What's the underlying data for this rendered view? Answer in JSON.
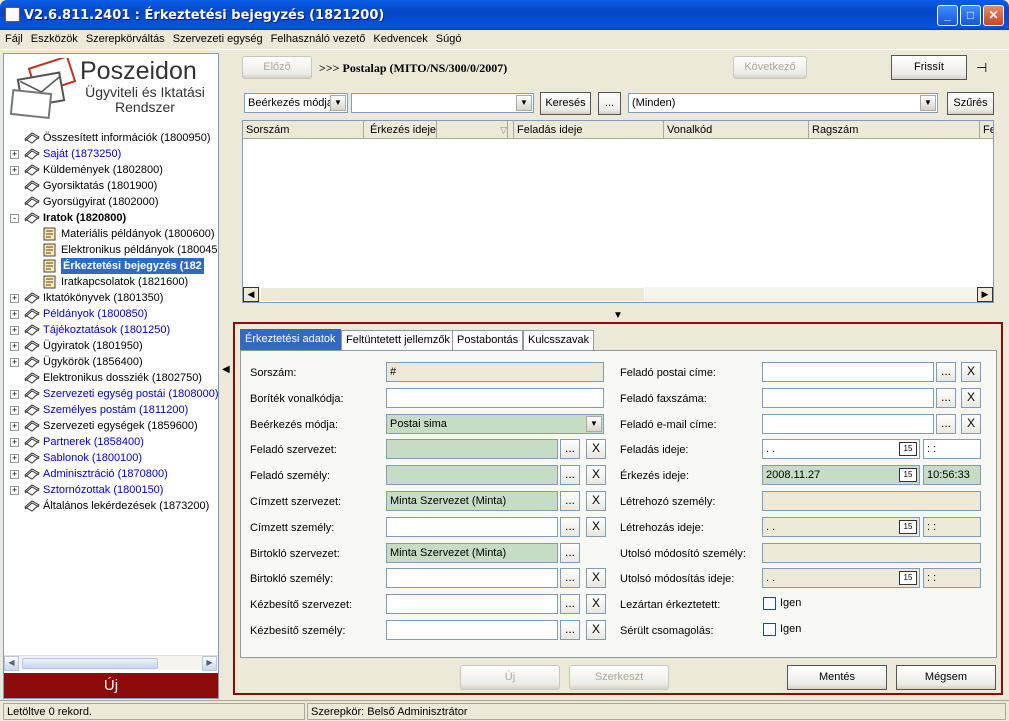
{
  "window": {
    "title": "V2.6.811.2401 : Érkeztetési bejegyzés (1821200)"
  },
  "menu": [
    "Fájl",
    "Eszközök",
    "Szerepkörváltás",
    "Szervezeti egység",
    "Felhasználó vezető",
    "Kedvencek",
    "Súgó"
  ],
  "logo": {
    "name": "Poszeidon",
    "subtitle1": "Ügyviteli és Iktatási",
    "subtitle2": "Rendszer"
  },
  "tree": [
    {
      "label": "Összesített információk (1800950)",
      "blue": false,
      "expander": "",
      "bold": false,
      "selected": false,
      "level": 0
    },
    {
      "label": "Saját (1873250)",
      "blue": true,
      "expander": "+",
      "bold": false,
      "selected": false,
      "level": 0
    },
    {
      "label": "Küldemények (1802800)",
      "blue": false,
      "expander": "+",
      "bold": false,
      "selected": false,
      "level": 0
    },
    {
      "label": "Gyorsiktatás (1801900)",
      "blue": false,
      "expander": "",
      "bold": false,
      "selected": false,
      "level": 0
    },
    {
      "label": "Gyorsügyirat (1802000)",
      "blue": false,
      "expander": "",
      "bold": false,
      "selected": false,
      "level": 0
    },
    {
      "label": "Iratok (1820800)",
      "blue": false,
      "expander": "-",
      "bold": true,
      "selected": false,
      "level": 0
    },
    {
      "label": "Materiális példányok (1800600)",
      "blue": false,
      "expander": "",
      "bold": false,
      "selected": false,
      "level": 1
    },
    {
      "label": "Elektronikus példányok (180045",
      "blue": false,
      "expander": "",
      "bold": false,
      "selected": false,
      "level": 1
    },
    {
      "label": "Érkeztetési bejegyzés (182",
      "blue": false,
      "expander": "",
      "bold": false,
      "selected": true,
      "level": 1
    },
    {
      "label": "Iratkapcsolatok (1821600)",
      "blue": false,
      "expander": "",
      "bold": false,
      "selected": false,
      "level": 1
    },
    {
      "label": "Iktatókönyvek (1801350)",
      "blue": false,
      "expander": "+",
      "bold": false,
      "selected": false,
      "level": 0
    },
    {
      "label": "Példányok (1800850)",
      "blue": true,
      "expander": "+",
      "bold": false,
      "selected": false,
      "level": 0
    },
    {
      "label": "Tájékoztatások (1801250)",
      "blue": true,
      "expander": "+",
      "bold": false,
      "selected": false,
      "level": 0
    },
    {
      "label": "Ügyiratok (1801950)",
      "blue": false,
      "expander": "+",
      "bold": false,
      "selected": false,
      "level": 0
    },
    {
      "label": "Ügykörök (1856400)",
      "blue": false,
      "expander": "+",
      "bold": false,
      "selected": false,
      "level": 0
    },
    {
      "label": "Elektronikus dossziék (1802750)",
      "blue": false,
      "expander": "",
      "bold": false,
      "selected": false,
      "level": 0
    },
    {
      "label": "Szervezeti egység postái (1808000)",
      "blue": true,
      "expander": "+",
      "bold": false,
      "selected": false,
      "level": 0
    },
    {
      "label": "Személyes postám (1811200)",
      "blue": true,
      "expander": "+",
      "bold": false,
      "selected": false,
      "level": 0
    },
    {
      "label": "Szervezeti egységek (1859600)",
      "blue": false,
      "expander": "+",
      "bold": false,
      "selected": false,
      "level": 0
    },
    {
      "label": "Partnerek (1858400)",
      "blue": true,
      "expander": "+",
      "bold": false,
      "selected": false,
      "level": 0
    },
    {
      "label": "Sablonok (1800100)",
      "blue": true,
      "expander": "+",
      "bold": false,
      "selected": false,
      "level": 0
    },
    {
      "label": "Adminisztráció (1870800)",
      "blue": true,
      "expander": "+",
      "bold": false,
      "selected": false,
      "level": 0
    },
    {
      "label": "Sztornózottak (1800150)",
      "blue": true,
      "expander": "+",
      "bold": false,
      "selected": false,
      "level": 0
    },
    {
      "label": "Általános lekérdezések (1873200)",
      "blue": false,
      "expander": "",
      "bold": false,
      "selected": false,
      "level": 0
    }
  ],
  "left": {
    "uj_button": "Új"
  },
  "nav": {
    "prev": "Előző",
    "breadcrumb": ">>> Postalap (MITO/NS/300/0/2007)",
    "next": "Következő",
    "refresh": "Frissít"
  },
  "search": {
    "field_select": "Beérkezés módja",
    "value": "",
    "search_button": "Keresés",
    "ellipsis": "...",
    "filter_select": "(Minden)",
    "filter_button": "Szűrés"
  },
  "grid": {
    "columns": [
      "Sorszám",
      "Érkezés ideje",
      "Feladás ideje",
      "Vonalkód",
      "Ragszám",
      "Fe"
    ]
  },
  "tabs": [
    "Érkeztetési adatok",
    "Feltüntetett jellemzők",
    "Postabontás",
    "Kulcsszavak"
  ],
  "form_left": [
    {
      "label": "Sorszám:",
      "value": "#"
    },
    {
      "label": "Boríték vonalkódja:",
      "value": ""
    },
    {
      "label": "Beérkezés módja:",
      "value": "Postai sima"
    },
    {
      "label": "Feladó szervezet:",
      "value": ""
    },
    {
      "label": "Feladó személy:",
      "value": ""
    },
    {
      "label": "Címzett szervezet:",
      "value": "Minta Szervezet (Minta)"
    },
    {
      "label": "Címzett személy:",
      "value": ""
    },
    {
      "label": "Birtokló szervezet:",
      "value": "Minta Szervezet  (Minta)"
    },
    {
      "label": "Birtokló személy:",
      "value": ""
    },
    {
      "label": "Kézbesítő szervezet:",
      "value": ""
    },
    {
      "label": "Kézbesítő személy:",
      "value": ""
    }
  ],
  "form_right": [
    {
      "label": "Feladó postai címe:",
      "value": ""
    },
    {
      "label": "Feladó faxszáma:",
      "value": ""
    },
    {
      "label": "Feladó e-mail címe:",
      "value": ""
    },
    {
      "label": "Feladás ideje:",
      "date": ". .",
      "time": ": :"
    },
    {
      "label": "Érkezés ideje:",
      "date": "2008.11.27",
      "time": "10:56:33"
    },
    {
      "label": "Létrehozó személy:",
      "value": ""
    },
    {
      "label": "Létrehozás ideje:",
      "date": ". .",
      "time": ": :"
    },
    {
      "label": "Utolsó módosító személy:",
      "value": ""
    },
    {
      "label": "Utolsó módosítás ideje:",
      "date": ". .",
      "time": ": :"
    },
    {
      "label": "Lezártan érkeztetett:",
      "check": "Igen"
    },
    {
      "label": "Sérült csomagolás:",
      "check": "Igen"
    }
  ],
  "bottom": {
    "new": "Új",
    "edit": "Szerkeszt",
    "save": "Mentés",
    "cancel": "Mégsem"
  },
  "status": {
    "left": "Letöltve 0 rekord.",
    "right": "Szerepkör: Belső Adminisztrátor"
  },
  "symbols": {
    "ellipsis": "...",
    "clear": "X",
    "calendar": "15",
    "dropdown": "▼",
    "pin": "⊣"
  }
}
